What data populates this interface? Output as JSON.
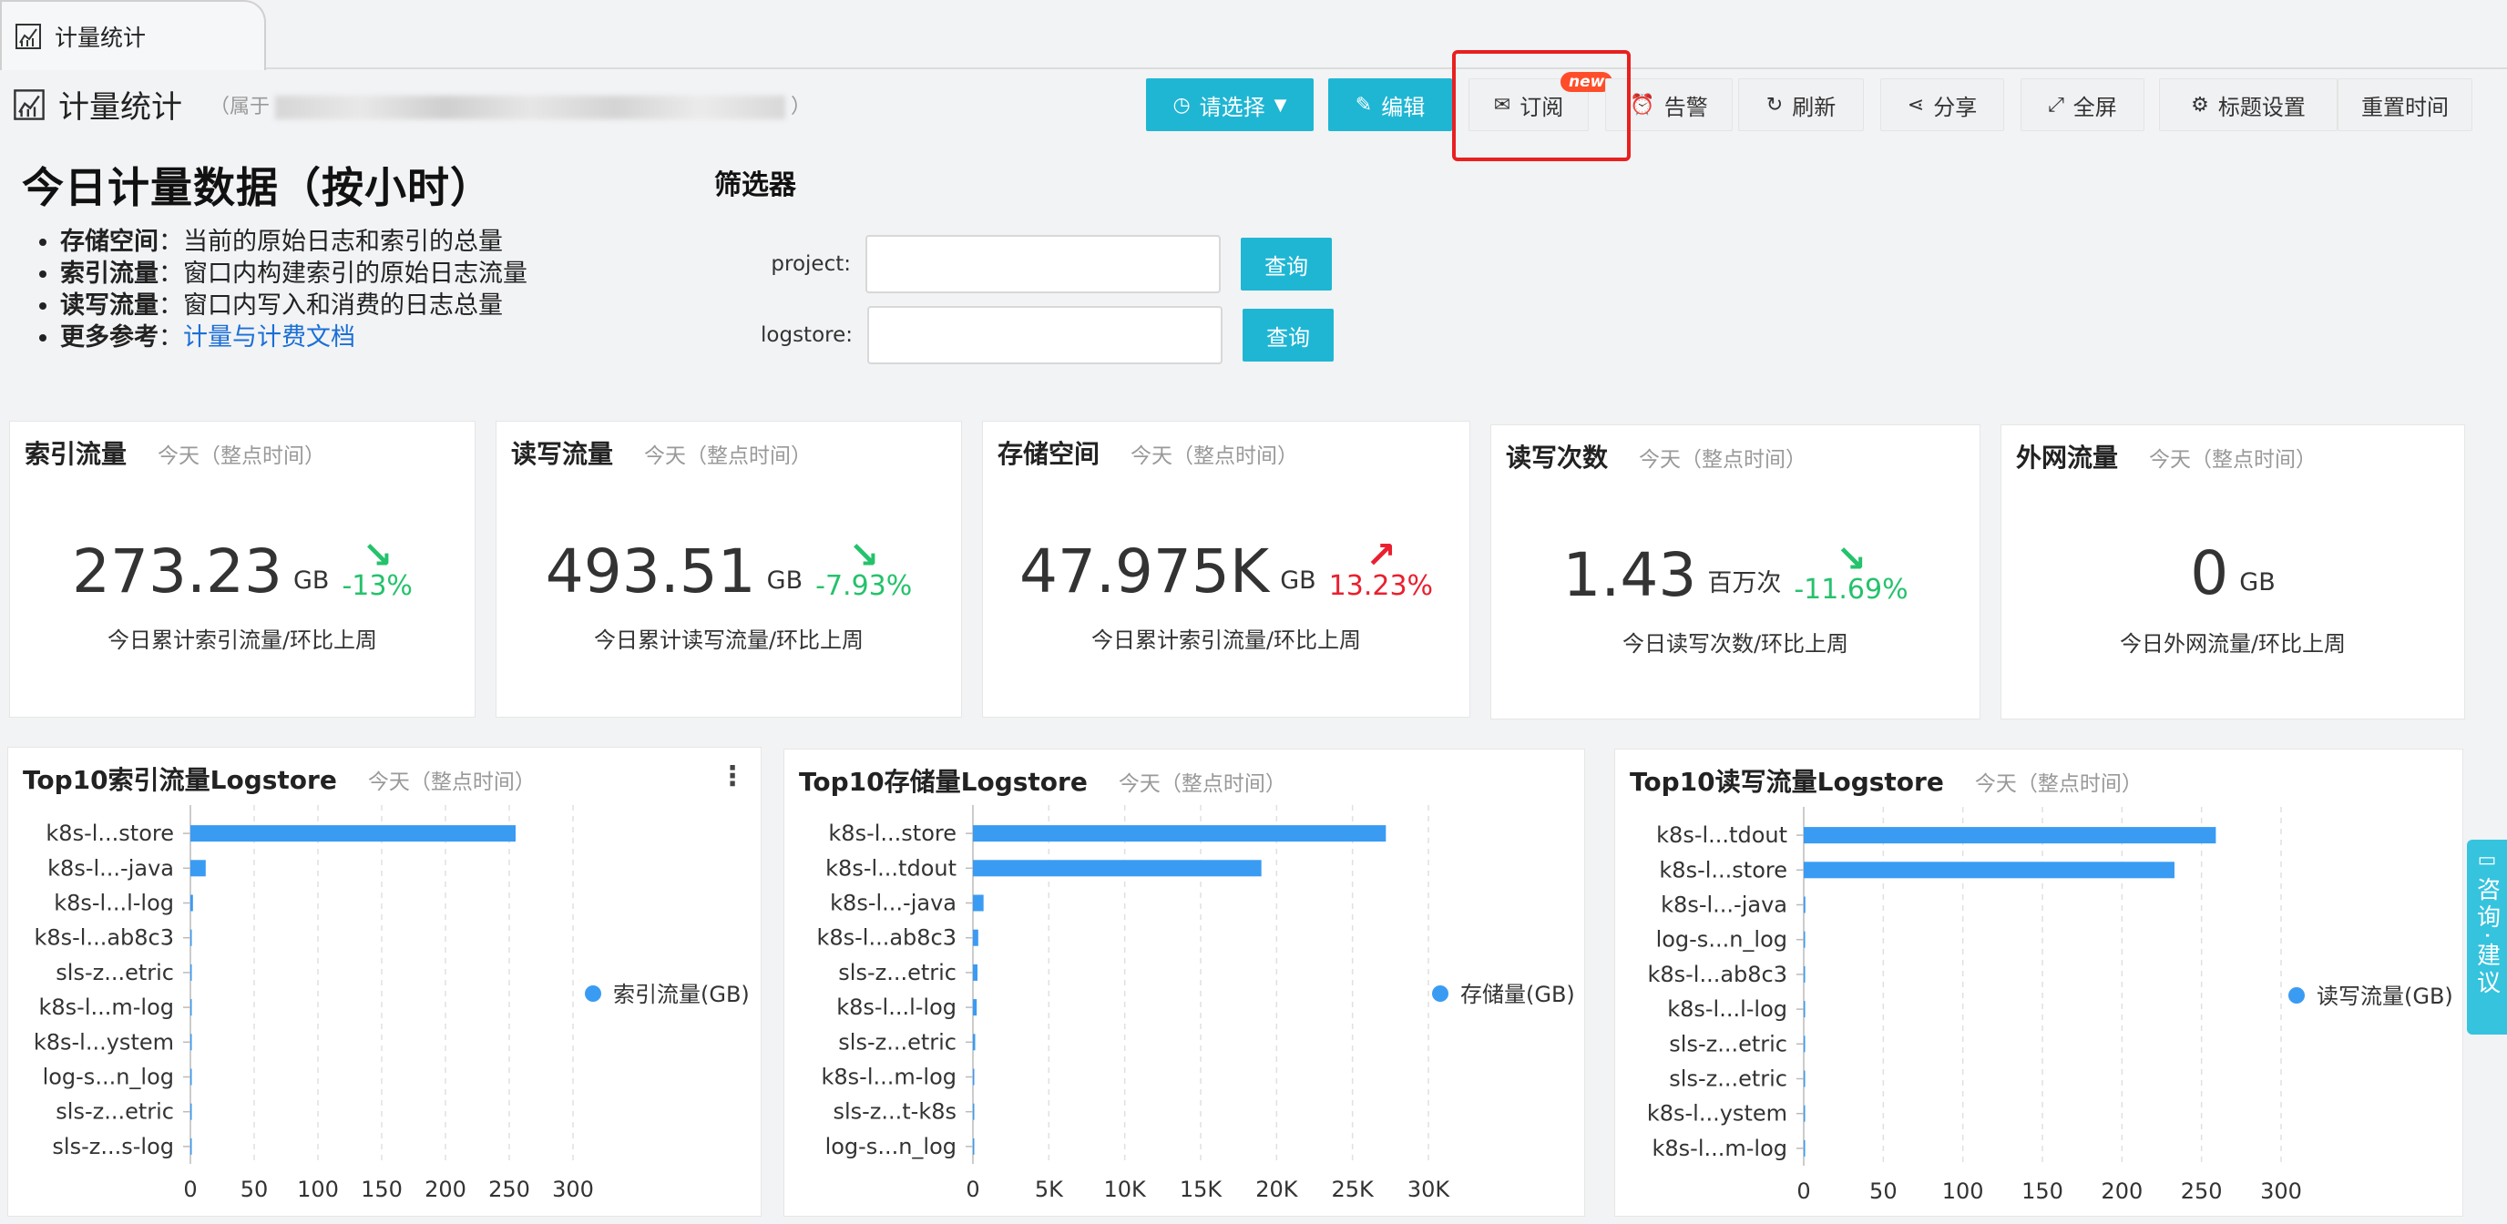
{
  "tab": {
    "label": "计量统计"
  },
  "header": {
    "title": "计量统计",
    "owner_prefix": "（属于",
    "owner_suffix": "）"
  },
  "toolbar": {
    "select_label": "请选择",
    "edit_label": "编辑",
    "subscribe_label": "订阅",
    "subscribe_badge": "new",
    "alert_label": "告警",
    "refresh_label": "刷新",
    "share_label": "分享",
    "fullscreen_label": "全屏",
    "title_settings_label": "标题设置",
    "reset_time_label": "重置时间"
  },
  "description": {
    "heading": "今日计量数据（按小时）",
    "items": [
      {
        "term": "存储空间",
        "text": "当前的原始日志和索引的总量"
      },
      {
        "term": "索引流量",
        "text": "窗口内构建索引的原始日志流量"
      },
      {
        "term": "读写流量",
        "text": "窗口内写入和消费的日志总量"
      },
      {
        "term": "更多参考",
        "link": "计量与计费文档"
      }
    ]
  },
  "filter": {
    "title": "筛选器",
    "project_label": "project:",
    "logstore_label": "logstore:",
    "query_label": "查询"
  },
  "kpis": [
    {
      "title": "索引流量",
      "subtitle": "今天（整点时间）",
      "value": "273.23",
      "unit": "GB",
      "change": "-13%",
      "trend": "down",
      "caption": "今日累计索引流量/环比上周"
    },
    {
      "title": "读写流量",
      "subtitle": "今天（整点时间）",
      "value": "493.51",
      "unit": "GB",
      "change": "-7.93%",
      "trend": "down",
      "caption": "今日累计读写流量/环比上周"
    },
    {
      "title": "存储空间",
      "subtitle": "今天（整点时间）",
      "value": "47.975K",
      "unit": "GB",
      "change": "13.23%",
      "trend": "up",
      "caption": "今日累计索引流量/环比上周"
    },
    {
      "title": "读写次数",
      "subtitle": "今天（整点时间）",
      "value": "1.43",
      "unit": "百万次",
      "change": "-11.69%",
      "trend": "down",
      "caption": "今日读写次数/环比上周"
    },
    {
      "title": "外网流量",
      "subtitle": "今天（整点时间）",
      "value": "0",
      "unit": "GB",
      "change": "",
      "trend": "none",
      "caption": "今日外网流量/环比上周"
    }
  ],
  "chart_data": [
    {
      "type": "bar",
      "orientation": "horizontal",
      "title": "Top10索引流量Logstore",
      "subtitle": "今天（整点时间）",
      "categories": [
        "k8s-l...store",
        "k8s-l...-java",
        "k8s-l...l-log",
        "k8s-l...ab8c3",
        "sls-z...etric",
        "k8s-l...m-log",
        "k8s-l...ystem",
        "log-s...n_log",
        "sls-z...etric",
        "sls-z...s-log"
      ],
      "series": [
        {
          "name": "索引流量(GB)",
          "values": [
            255,
            12,
            2,
            1,
            0.5,
            0.3,
            0.2,
            0.1,
            0.1,
            0.05
          ]
        }
      ],
      "xlim": [
        0,
        300
      ],
      "xticks": [
        "0",
        "50",
        "100",
        "150",
        "200",
        "250",
        "300"
      ],
      "grid": true,
      "legend": "right",
      "color": "#3a9bf3"
    },
    {
      "type": "bar",
      "orientation": "horizontal",
      "title": "Top10存储量Logstore",
      "subtitle": "今天（整点时间）",
      "categories": [
        "k8s-l...store",
        "k8s-l...tdout",
        "k8s-l...-java",
        "k8s-l...ab8c3",
        "sls-z...etric",
        "k8s-l...l-log",
        "sls-z...etric",
        "k8s-l...m-log",
        "sls-z...t-k8s",
        "log-s...n_log"
      ],
      "series": [
        {
          "name": "存储量(GB)",
          "values": [
            27200,
            19000,
            700,
            350,
            300,
            250,
            150,
            80,
            40,
            20
          ]
        }
      ],
      "xlim": [
        0,
        30000
      ],
      "xticks": [
        "0",
        "5K",
        "10K",
        "15K",
        "20K",
        "25K",
        "30K"
      ],
      "grid": true,
      "legend": "right",
      "color": "#3a9bf3"
    },
    {
      "type": "bar",
      "orientation": "horizontal",
      "title": "Top10读写流量Logstore",
      "subtitle": "今天（整点时间）",
      "categories": [
        "k8s-l...tdout",
        "k8s-l...store",
        "k8s-l...-java",
        "log-s...n_log",
        "k8s-l...ab8c3",
        "k8s-l...l-log",
        "sls-z...etric",
        "sls-z...etric",
        "k8s-l...ystem",
        "k8s-l...m-log"
      ],
      "series": [
        {
          "name": "读写流量(GB)",
          "values": [
            259,
            233,
            1,
            0.5,
            0.3,
            0.2,
            0.1,
            0.1,
            0.05,
            0.05
          ]
        }
      ],
      "xlim": [
        0,
        300
      ],
      "xticks": [
        "0",
        "50",
        "100",
        "150",
        "200",
        "250",
        "300"
      ],
      "grid": true,
      "legend": "right",
      "color": "#3a9bf3"
    }
  ],
  "side_widget": {
    "text": "咨询·建议"
  },
  "colors": {
    "primary": "#1fb6d4",
    "bar": "#3a9bf3",
    "down": "#25c26c",
    "up": "#ea1f2f",
    "highlight": "#e82020"
  },
  "icons": {
    "tab": "chart-icon",
    "select": "clock-icon",
    "edit": "pencil-icon",
    "subscribe": "mail-icon",
    "alert": "alarm-icon",
    "refresh": "refresh-icon",
    "share": "share-icon",
    "fullscreen": "expand-icon",
    "title_settings": "gear-icon",
    "more": "more-vertical-icon"
  }
}
